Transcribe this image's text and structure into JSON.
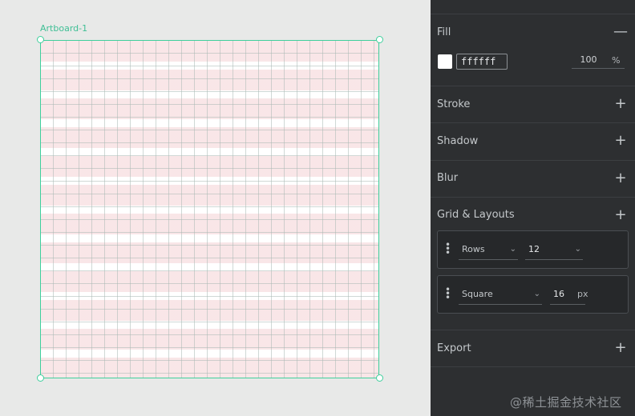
{
  "canvas": {
    "artboard_title": "Artboard-1"
  },
  "inspector": {
    "fill": {
      "label": "Fill",
      "toggle": "—",
      "color_hex": "ffffff",
      "opacity": "100",
      "opacity_unit": "%"
    },
    "stroke": {
      "label": "Stroke",
      "toggle": "+"
    },
    "shadow": {
      "label": "Shadow",
      "toggle": "+"
    },
    "blur": {
      "label": "Blur",
      "toggle": "+"
    },
    "grid_layouts": {
      "label": "Grid & Layouts",
      "toggle": "+",
      "items": [
        {
          "type": "Rows",
          "value": "12",
          "unit": ""
        },
        {
          "type": "Square",
          "value": "16",
          "unit": "px"
        }
      ]
    },
    "export": {
      "label": "Export",
      "toggle": "+"
    }
  },
  "watermark": "@稀土掘金技术社区",
  "colors": {
    "accent": "#3fcf9c",
    "panel_bg": "#2d2f31",
    "canvas_bg": "#e8e9e8",
    "grid_row_fill": "#f4d2d4"
  }
}
